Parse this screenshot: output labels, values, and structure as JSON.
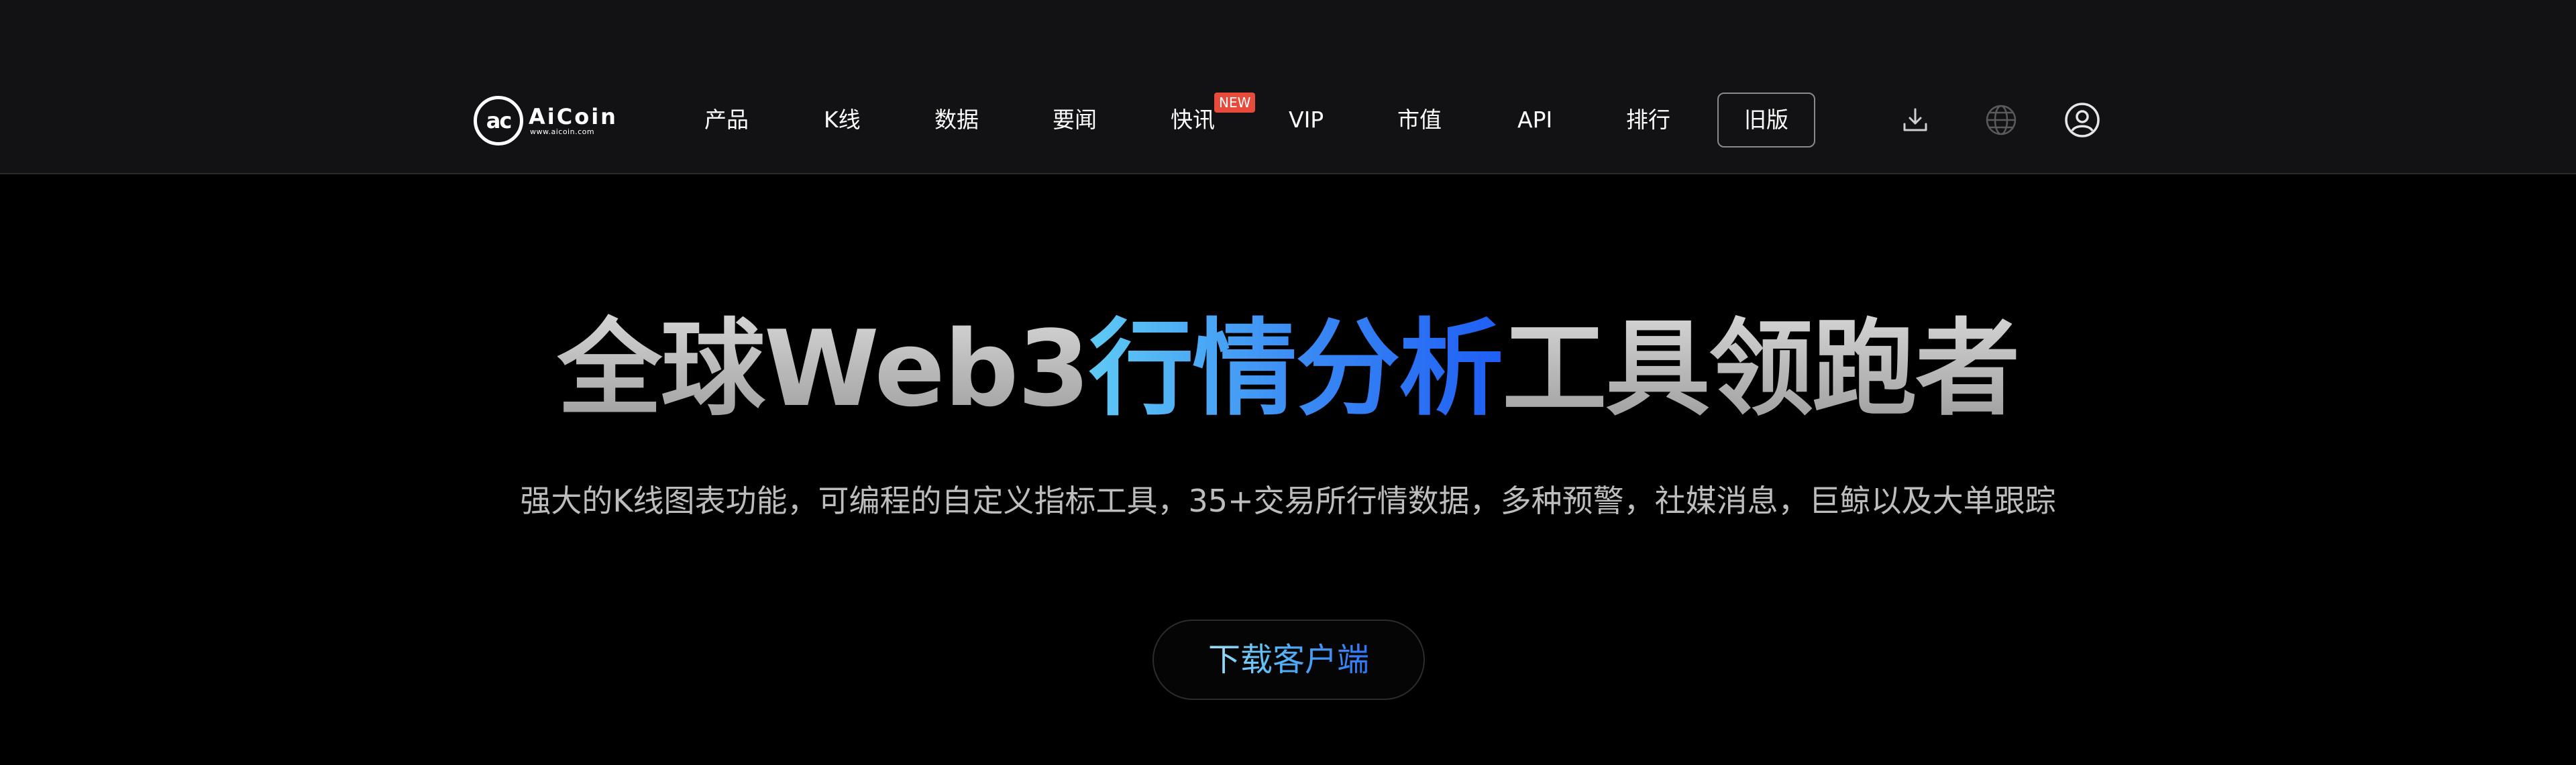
{
  "header": {
    "logo": {
      "mark": "ac",
      "name": "AiCoin",
      "url": "www.aicoin.com"
    },
    "nav": [
      {
        "label": "产品"
      },
      {
        "label": "K线"
      },
      {
        "label": "数据"
      },
      {
        "label": "要闻"
      },
      {
        "label": "快讯",
        "badge": "NEW"
      },
      {
        "label": "VIP"
      },
      {
        "label": "市值"
      },
      {
        "label": "API"
      },
      {
        "label": "排行"
      }
    ],
    "legacy_label": "旧版",
    "icons": [
      "download-icon",
      "globe-icon",
      "user-icon"
    ]
  },
  "hero": {
    "title_part1": "全球Web3",
    "title_highlight": "行情分析",
    "title_part2": "工具领跑者",
    "subtitle": "强大的K线图表功能，可编程的自定义指标工具，35+交易所行情数据，多种预警，社媒消息，巨鲸以及大单跟踪",
    "cta_label": "下载客户端"
  },
  "colors": {
    "background": "#000000",
    "header_bg": "#121214",
    "badge": "#e74b3c",
    "accent_start": "#5fcaf4",
    "accent_end": "#1f5ef4"
  }
}
